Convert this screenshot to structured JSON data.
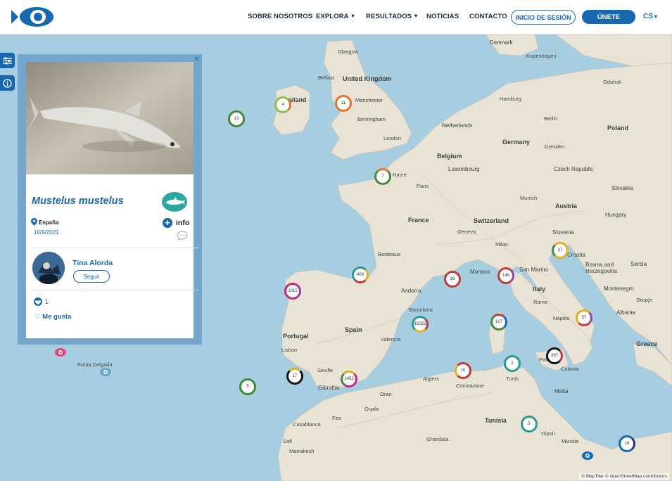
{
  "header": {
    "nav": [
      "SOBRE NOSOTROS",
      "EXPLORA",
      "RESULTADOS",
      "NOTICIAS",
      "CONTACTO"
    ],
    "login": "INICIO DE SESIÓN",
    "join": "ÚNETE",
    "lang": "CS"
  },
  "popup": {
    "species": "Mustelus mustelus",
    "country": "España",
    "date": "10/9/2021",
    "info": "info",
    "user": "Tina Alorda",
    "follow": "Seguir",
    "likes": "1",
    "like_link": "Me gusta"
  },
  "map": {
    "labels": {
      "denmark": "Denmark",
      "kopenhagen": "Kopenhagen",
      "glasgow": "Glasgow",
      "belfast": "Belfast",
      "uk": "United Kingdom",
      "ireland": "Ireland",
      "manchester": "Manchester",
      "birmingham": "Birmingham",
      "london": "London",
      "gdansk": "Gdańsk",
      "hamburg": "Hamburg",
      "berlin": "Berlin",
      "netherlands": "Netherlands",
      "poland": "Poland",
      "germany": "Germany",
      "dresden": "Dresden",
      "belgium": "Belgium",
      "luxembourg": "Luxembourg",
      "czech": "Czech Republic",
      "havre": "Havre",
      "paris": "Paris",
      "slovakia": "Slovakia",
      "munich": "Munich",
      "austria": "Austria",
      "france": "France",
      "switzerland": "Switzerland",
      "hungary": "Hungary",
      "geneva": "Geneva",
      "slovenia": "Slovenia",
      "milan": "Milan",
      "croatia": "Croatia",
      "bordeaux": "Bordeaux",
      "serbia": "Serbia",
      "bosnia": "Bosnia and Herzegovina",
      "monaco": "Monaco",
      "sanmarino": "San Marino",
      "andorra": "Andorra",
      "italy": "Italy",
      "montenegro": "Montenegro",
      "rome": "Rome",
      "skopje": "Skopje",
      "barcelona": "Barcelona",
      "albania": "Albania",
      "portugal": "Portugal",
      "spain": "Spain",
      "naples": "Naples",
      "greece": "Greece",
      "valencia": "Valencia",
      "lisbon": "Lisbon",
      "portadelgada": "Ponta Delgada",
      "seville": "Seville",
      "palermo": "Palermo",
      "catania": "Catania",
      "algiers": "Algiers",
      "gibraltar": "Gibraltar",
      "tunis": "Tunis",
      "constantine": "Constantine",
      "oran": "Oran",
      "malta": "Malta",
      "oujda": "Oujda",
      "fes": "Fes",
      "casablanca": "Casablanca",
      "tunisia": "Tunisia",
      "tripoli": "Tripoli",
      "misrate": "Misrate",
      "safi": "Safi",
      "ghardaia": "Ghardaïa",
      "marrakesh": "Marrakesh"
    },
    "clusters": [
      "4",
      "11",
      "13",
      "7",
      "409",
      "1015",
      "17",
      "1452",
      "15055",
      "5",
      "36",
      "146",
      "27",
      "107",
      "57",
      "10",
      "2",
      "397",
      "5",
      "16"
    ],
    "attribution": "© MapTiler © OpenStreetMap contributors"
  }
}
